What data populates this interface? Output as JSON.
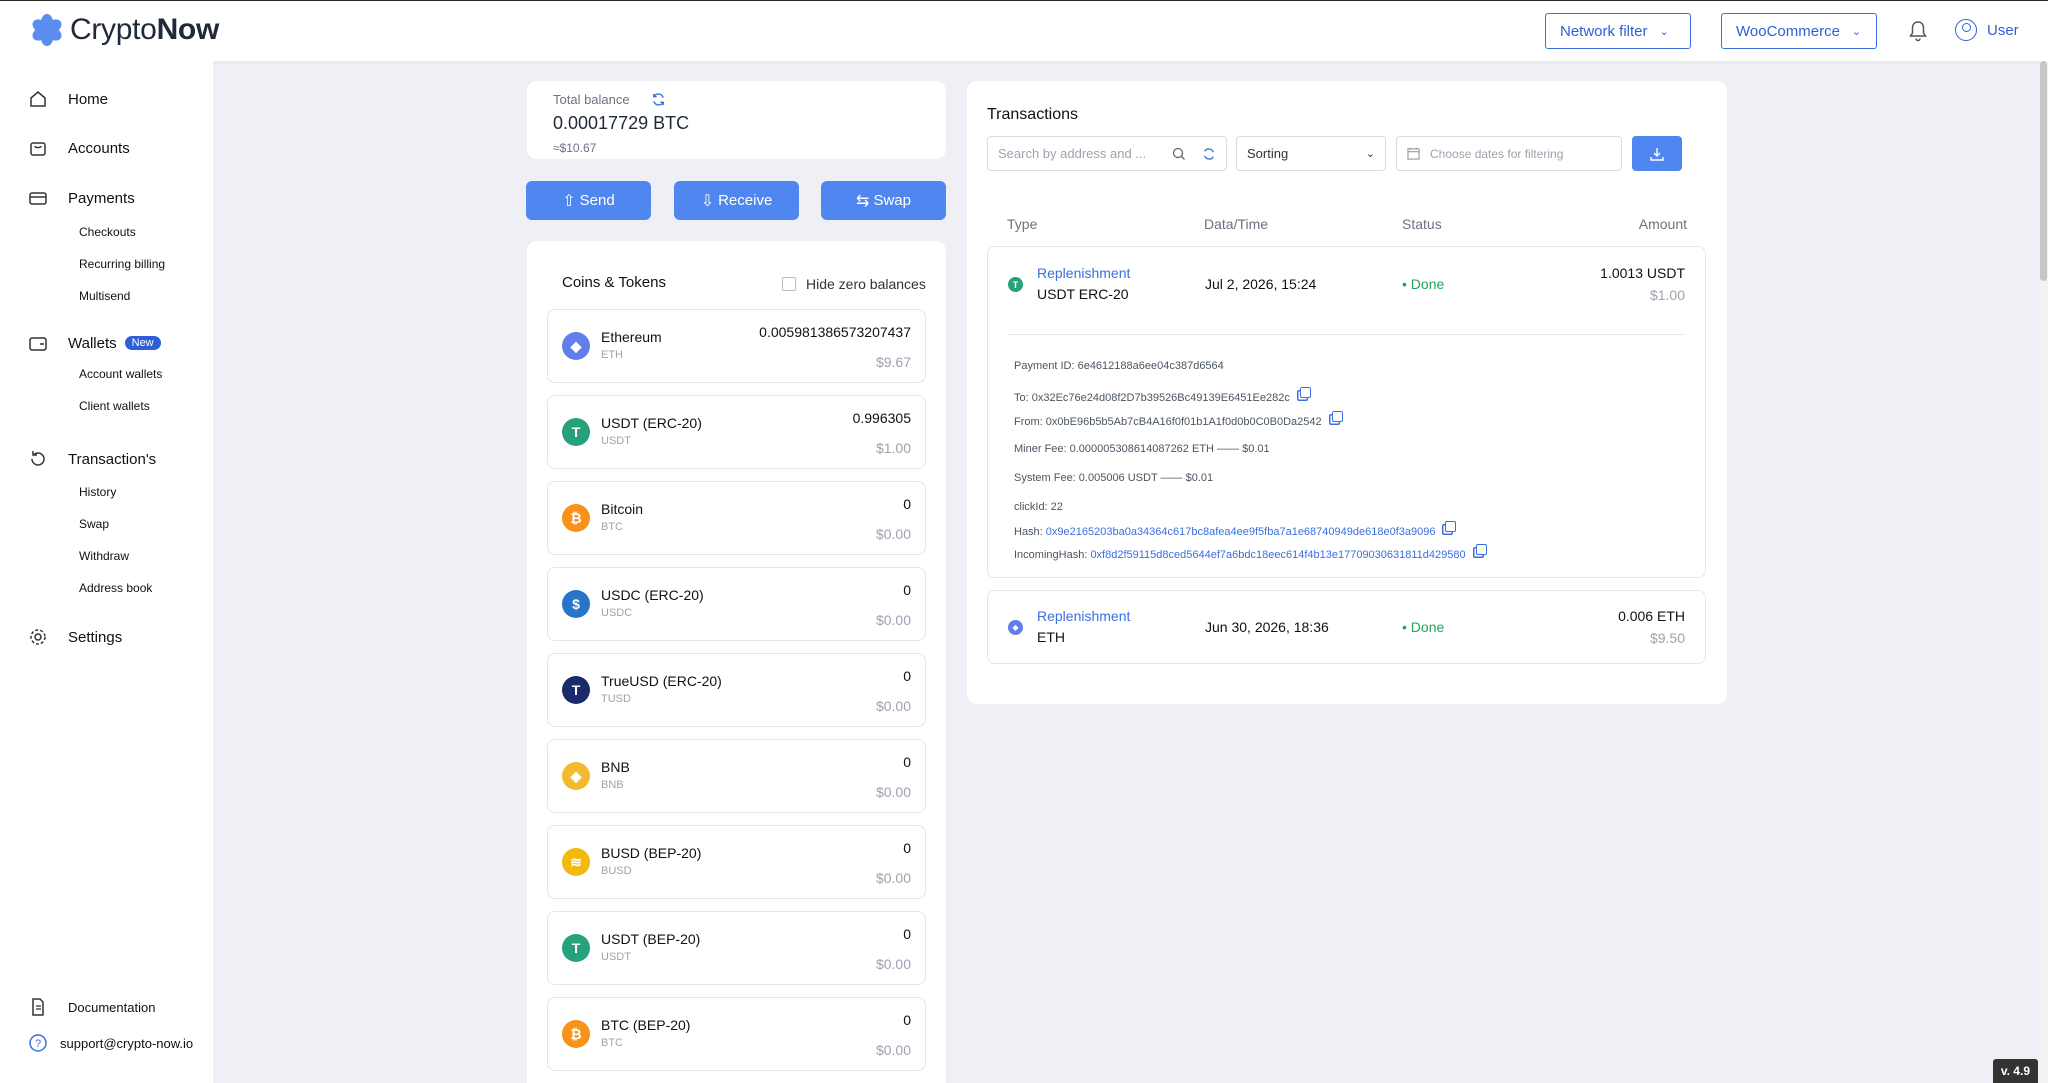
{
  "brand": {
    "name_light": "Crypto",
    "name_bold": "Now"
  },
  "header": {
    "network_filter": "Network filter",
    "store": "WooCommerce",
    "user": "User",
    "bell_icon": "bell-icon"
  },
  "sidebar": {
    "home": "Home",
    "accounts": "Accounts",
    "payments": "Payments",
    "payments_sub": [
      "Checkouts",
      "Recurring billing",
      "Multisend"
    ],
    "wallets": "Wallets",
    "wallets_badge": "New",
    "wallets_sub": [
      "Account wallets",
      "Client wallets"
    ],
    "transactions": "Transaction's",
    "transactions_sub": [
      "History",
      "Swap",
      "Withdraw",
      "Address book"
    ],
    "settings": "Settings",
    "documentation": "Documentation",
    "support": "support@crypto-now.io"
  },
  "balance": {
    "label": "Total balance",
    "value": "0.00017729 BTC",
    "usd": "≈$10.67"
  },
  "actions": {
    "send": "Send",
    "receive": "Receive",
    "swap": "Swap"
  },
  "coins": {
    "title": "Coins & Tokens",
    "hide_zero": "Hide zero balances",
    "items": [
      {
        "name": "Ethereum",
        "symbol": "ETH",
        "amount": "0.005981386573207437",
        "usd": "$9.67",
        "color": "#627eea",
        "glyph": "◆"
      },
      {
        "name": "USDT (ERC-20)",
        "symbol": "USDT",
        "amount": "0.996305",
        "usd": "$1.00",
        "color": "#26a17b",
        "glyph": "T"
      },
      {
        "name": "Bitcoin",
        "symbol": "BTC",
        "amount": "0",
        "usd": "$0.00",
        "color": "#f7931a",
        "glyph": "₿"
      },
      {
        "name": "USDC (ERC-20)",
        "symbol": "USDC",
        "amount": "0",
        "usd": "$0.00",
        "color": "#2775ca",
        "glyph": "$"
      },
      {
        "name": "TrueUSD (ERC-20)",
        "symbol": "TUSD",
        "amount": "0",
        "usd": "$0.00",
        "color": "#1a2b6b",
        "glyph": "T"
      },
      {
        "name": "BNB",
        "symbol": "BNB",
        "amount": "0",
        "usd": "$0.00",
        "color": "#f3ba2f",
        "glyph": "◆"
      },
      {
        "name": "BUSD (BEP-20)",
        "symbol": "BUSD",
        "amount": "0",
        "usd": "$0.00",
        "color": "#f0b90b",
        "glyph": "≋"
      },
      {
        "name": "USDT (BEP-20)",
        "symbol": "USDT",
        "amount": "0",
        "usd": "$0.00",
        "color": "#26a17b",
        "glyph": "T"
      },
      {
        "name": "BTC (BEP-20)",
        "symbol": "BTC",
        "amount": "0",
        "usd": "$0.00",
        "color": "#f7931a",
        "glyph": "₿"
      }
    ]
  },
  "transactions": {
    "title": "Transactions",
    "search_placeholder": "Search by address and ...",
    "sorting": "Sorting",
    "dates_placeholder": "Choose dates for filtering",
    "headers": {
      "type": "Type",
      "datetime": "Data/Time",
      "status": "Status",
      "amount": "Amount"
    },
    "rows": [
      {
        "type": "Replenishment",
        "currency": "USDT ERC-20",
        "date": "Jul 2, 2026, 15:24",
        "status": "• Done",
        "amount": "1.0013 USDT",
        "usd": "$1.00",
        "color": "#26a17b",
        "glyph": "T"
      },
      {
        "type": "Replenishment",
        "currency": "ETH",
        "date": "Jun 30, 2026, 18:36",
        "status": "• Done",
        "amount": "0.006 ETH",
        "usd": "$9.50",
        "color": "#627eea",
        "glyph": "◆"
      }
    ],
    "details": {
      "payment_id": "Payment ID: 6e4612188a6ee04c387d6564",
      "to": "To: 0x32Ec76e24d08f2D7b39526Bc49139E6451Ee282c",
      "from": "From: 0x0bE96b5b5Ab7cB4A16f0f01b1A1f0d0b0C0B0Da2542",
      "miner_fee": "Miner Fee: 0.000005308614087262 ETH —— $0.01",
      "system_fee": "System Fee: 0.005006 USDT —— $0.01",
      "click_id": "clickId: 22",
      "hash_label": "Hash: ",
      "hash": "0x9e2165203ba0a34364c617bc8afea4ee9f5fba7a1e68740949de618e0f3a9096",
      "incoming_label": "IncomingHash: ",
      "incoming_hash": "0xf8d2f59115d8ced5644ef7a6bdc18eec614f4b13e17709030631811d429580"
    }
  },
  "version": "v. 4.9"
}
